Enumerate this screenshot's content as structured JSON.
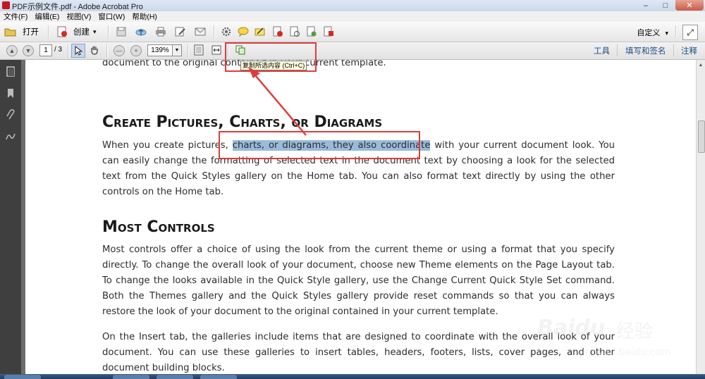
{
  "window": {
    "title": "PDF示例文件.pdf - Adobe Acrobat Pro",
    "controls": [
      "–",
      "□",
      "✕"
    ]
  },
  "menubar": {
    "items": [
      "文件(F)",
      "编辑(E)",
      "视图(V)",
      "窗口(W)",
      "帮助(H)"
    ]
  },
  "toolbar": {
    "open_label": "打开",
    "create_label": "创建",
    "create_dropdown": "▾",
    "customize_label": "自定义",
    "customize_dropdown": "▾",
    "expand_icon": "⤢",
    "icons": [
      "save-icon",
      "cloud-upload-icon",
      "print-icon",
      "edit-icon",
      "email-icon",
      "gear-icon",
      "comment-icon",
      "highlight-icon",
      "delete-page-icon",
      "page-icon",
      "page-sign-icon",
      "export-icon"
    ]
  },
  "navbar": {
    "current_page": "1",
    "total_pages": "/ 3",
    "zoom_value": "139%",
    "panel_links": [
      "工具",
      "填写和签名",
      "注释"
    ]
  },
  "tooltip": {
    "text": "复制所选内容 (Ctrl+C)"
  },
  "document": {
    "para_top_line": "gallery and the Quick Styles gallery provide reset commands so that you can always restore the look of your document to the original contained in your current template.",
    "heading1": "Create Pictures, Charts, or Diagrams",
    "para2_before": "When you create pictures, ",
    "para2_selected": "charts, or diagrams, they also coordinate",
    "para2_after": " with your current document look. You can easily change the formatting of selected text in the document text by choosing a look for the selected text from the Quick Styles gallery on the Home tab. You can also format text directly by using the other controls on the Home tab.",
    "heading2": "Most Controls",
    "para3": "Most controls offer a choice of using the look from the current theme or using a format that you specify directly. To change the overall look of your document, choose new Theme elements on the Page Layout tab. To change the looks available in the Quick Style gallery, use the Change Current Quick Style Set command. Both the Themes gallery and the Quick Styles gallery provide reset commands so that you can always restore the look of your document to the original contained in your current template.",
    "para4": "On the Insert tab, the galleries include items that are designed to coordinate with the overall look of your document. You can use these galleries to insert tables, headers, footers, lists, cover pages, and other document building blocks."
  },
  "watermark": {
    "brand": "Baidu",
    "label": "经验",
    "url": "jingyan.baidu.com"
  },
  "colors": {
    "selection": "#99bbdb",
    "annotation_red": "#e03c3c",
    "panel_link": "#1e4e86",
    "nav_pane": "#3f3f3f"
  }
}
